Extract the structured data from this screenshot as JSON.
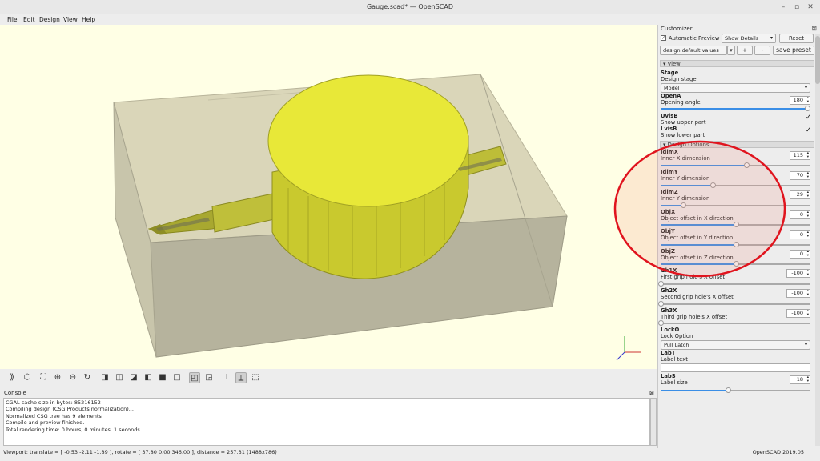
{
  "window": {
    "title": "Gauge.scad* — OpenSCAD"
  },
  "menu": [
    "File",
    "Edit",
    "Design",
    "View",
    "Help"
  ],
  "console": {
    "title": "Console",
    "lines": [
      "CGAL cache size in bytes: 85216152",
      "Compiling design (CSG Products normalization)...",
      "Normalized CSG tree has 9 elements",
      "Compile and preview finished.",
      "Total rendering time: 0 hours, 0 minutes, 1 seconds"
    ]
  },
  "status": {
    "viewport": "Viewport: translate = [ -0.53 -2.11 -1.89 ], rotate = [ 37.80 0.00 346.00 ], distance = 257.31 (1488x786)",
    "version": "OpenSCAD 2019.05"
  },
  "customizer": {
    "title": "Customizer",
    "auto_preview_label": "Automatic Preview",
    "show_details": "Show Details",
    "reset": "Reset",
    "preset": "design default values",
    "plus": "+",
    "minus": "-",
    "save_preset": "save preset",
    "groups": {
      "view": "View",
      "design": "Design Options"
    },
    "params": {
      "stage": {
        "name": "Stage",
        "desc": "Design stage",
        "value": "Model"
      },
      "opena": {
        "name": "OpenA",
        "desc": "Opening angle",
        "value": "180",
        "frac": 0.98
      },
      "uvisb": {
        "name": "UvisB",
        "desc": "Show upper part",
        "checked": true
      },
      "lvisb": {
        "name": "LvisB",
        "desc": "Show lower part",
        "checked": true
      },
      "idimx": {
        "name": "IdimX",
        "desc": "Inner X dimension",
        "value": "115",
        "frac": 0.57
      },
      "idimy": {
        "name": "IdimY",
        "desc": "Inner Y dimension",
        "value": "70",
        "frac": 0.35
      },
      "idimz": {
        "name": "IdimZ",
        "desc": "Inner Y dimension",
        "value": "29",
        "frac": 0.15
      },
      "objx": {
        "name": "ObjX",
        "desc": "Object offset in X direction",
        "value": "0",
        "frac": 0.5
      },
      "objy": {
        "name": "ObjY",
        "desc": "Object offset in Y direction",
        "value": "0",
        "frac": 0.5
      },
      "objz": {
        "name": "ObjZ",
        "desc": "Object offset in Z direction",
        "value": "0",
        "frac": 0.5
      },
      "gh1x": {
        "name": "Gh1X",
        "desc": "First grip hole's X offset",
        "value": "-100",
        "frac": 0.0
      },
      "gh2x": {
        "name": "Gh2X",
        "desc": "Second grip hole's X offset",
        "value": "-100",
        "frac": 0.0
      },
      "gh3x": {
        "name": "Gh3X",
        "desc": "Third grip hole's X offset",
        "value": "-100",
        "frac": 0.0
      },
      "locko": {
        "name": "LockO",
        "desc": "Lock Option",
        "value": "Pull Latch"
      },
      "labt": {
        "name": "LabT",
        "desc": "Label text",
        "value": ""
      },
      "labs": {
        "name": "LabS",
        "desc": "Label size",
        "value": "18",
        "frac": 0.45
      }
    }
  },
  "colors": {
    "viewport_bg": "#ffffe5",
    "model_yellow": "#e8e838",
    "annotation_red": "#e0141e",
    "slider_blue": "#3a8ee6"
  }
}
